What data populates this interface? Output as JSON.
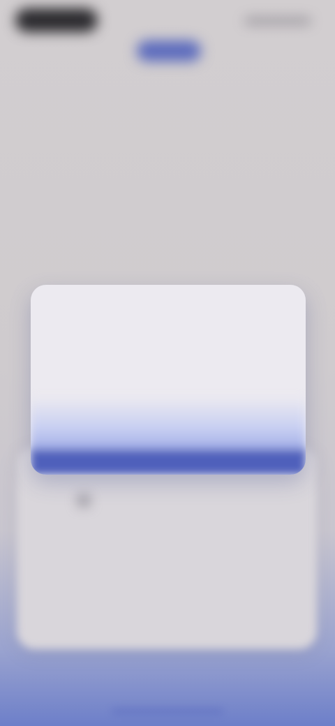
{
  "status_bar": {
    "time": ""
  },
  "header": {
    "logo_icon": "app-logo-icon"
  },
  "hero": {
    "title": "",
    "subtitle": ""
  },
  "modal": {
    "title": "",
    "body": "",
    "left_button_label": "",
    "right_button_label": ""
  },
  "options": {
    "items": [
      {
        "label": ""
      },
      {
        "label": ""
      },
      {
        "label": ""
      }
    ]
  },
  "colors": {
    "accent": "#4f60bb",
    "background": "#d2ced0",
    "gradient_bottom": "#6d7fc9"
  }
}
